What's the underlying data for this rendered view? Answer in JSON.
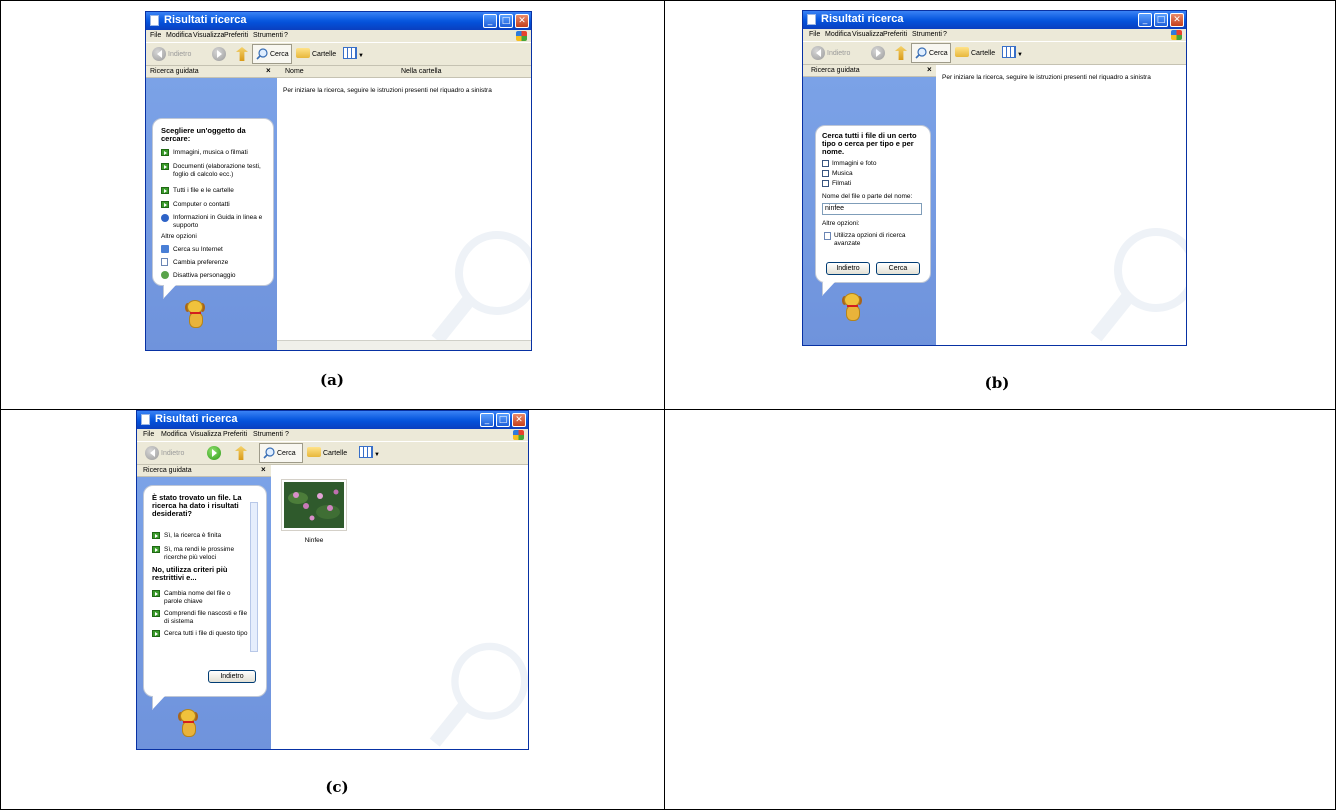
{
  "captions": {
    "a": "(a)",
    "b": "(b)",
    "c": "(c)"
  },
  "window": {
    "title": "Risultati ricerca",
    "menu": [
      "File",
      "Modifica",
      "Visualizza",
      "Preferiti",
      "Strumenti",
      "?"
    ],
    "toolbar": {
      "back": "Indietro",
      "search": "Cerca",
      "folders": "Cartelle"
    },
    "sidebar_title": "Ricerca guidata",
    "close_glyph": "×"
  },
  "panel_a": {
    "columns": {
      "name": "Nome",
      "folder": "Nella cartella"
    },
    "hint": "Per iniziare la ricerca, seguire le istruzioni presenti nel riquadro a sinistra",
    "balloon_title": "Scegliere un'oggetto da cercare:",
    "items": [
      "Immagini, musica o filmati",
      "Documenti (elaborazione testi, foglio di calcolo ecc.)",
      "Tutti i file e le cartelle",
      "Computer o contatti",
      "Informazioni in Guida in linea e supporto"
    ],
    "other_title": "Altre opzioni",
    "other_items": [
      "Cerca su Internet",
      "Cambia preferenze",
      "Disattiva personaggio"
    ]
  },
  "panel_b": {
    "hint": "Per iniziare la ricerca, seguire le istruzioni presenti nel riquadro a sinistra",
    "balloon_title": "Cerca tutti i file di un certo tipo o cerca per tipo e per nome.",
    "checkboxes": [
      "Immagini e foto",
      "Musica",
      "Filmati"
    ],
    "name_label": "Nome del file o parte del nome:",
    "name_value": "ninfee",
    "other_title": "Altre opzioni:",
    "advanced": "Utilizza opzioni di ricerca avanzate",
    "back_button": "Indietro",
    "search_button": "Cerca"
  },
  "panel_c": {
    "balloon_title": "È stato trovato un file. La ricerca ha dato i risultati desiderati?",
    "items": [
      "Sì, la ricerca è finita",
      "Sì, ma rendi le prossime ricerche più veloci"
    ],
    "sub_title": "No, utilizza criteri più restrittivi e...",
    "sub_items": [
      "Cambia nome del file o parole chiave",
      "Comprendi file nascosti e file di sistema",
      "Cerca tutti i file di questo tipo"
    ],
    "back_button": "Indietro",
    "result_label": "Ninfee"
  },
  "colors": {
    "titlebar": "#0a5ae0",
    "sidebar": "#7ba2e7",
    "chrome": "#ece9d8"
  }
}
